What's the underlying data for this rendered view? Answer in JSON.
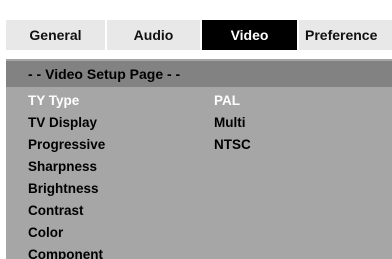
{
  "tabs": [
    {
      "label": "General"
    },
    {
      "label": "Audio"
    },
    {
      "label": "Video"
    },
    {
      "label": "Preference"
    }
  ],
  "active_tab": "Video",
  "page_title": "- -   Video Setup Page   - -",
  "menu_items": [
    {
      "label": "TY Type"
    },
    {
      "label": "TV Display"
    },
    {
      "label": "Progressive"
    },
    {
      "label": "Sharpness"
    },
    {
      "label": "Brightness"
    },
    {
      "label": "Contrast"
    },
    {
      "label": "Color"
    },
    {
      "label": "Component"
    }
  ],
  "options": [
    {
      "label": "PAL"
    },
    {
      "label": "Multi"
    },
    {
      "label": "NTSC"
    }
  ],
  "colors": {
    "background": "#a6a6a6",
    "header_bar": "#828282",
    "active_tab": "#000000",
    "highlight_text": "#ffffff"
  }
}
